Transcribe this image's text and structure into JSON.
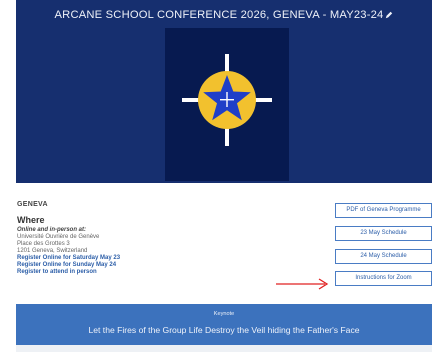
{
  "banner": {
    "title": "ARCANE SCHOOL CONFERENCE 2026, GENEVA - MAY23-24"
  },
  "location": {
    "section_title": "GENEVA",
    "where_heading": "Where",
    "online_label": "Online and in-person at:",
    "address_lines": [
      "Université Ouvrière de Genève",
      "Place des Grottes 3",
      "1201 Geneva, Switzerland"
    ],
    "links": [
      "Register Online for Saturday May 23",
      "Register Online for Sunday May 24",
      "Register to attend in person"
    ]
  },
  "buttons": [
    "PDF of Geneva Programme",
    "23 May Schedule",
    "24 May Schedule",
    "Instructions for Zoom"
  ],
  "keynote": {
    "label": "Keynote",
    "text": "Let the Fires of the Group Life Destroy the Veil hiding the Father's Face"
  },
  "colors": {
    "banner_bg": "#162f6f",
    "emblem_bg": "#071a50",
    "gold": "#f2c12e",
    "star_blue": "#1f3fc8",
    "link_blue": "#2c5ea8",
    "keynote_bg": "#3c72bd",
    "arrow_red": "#e02020"
  }
}
